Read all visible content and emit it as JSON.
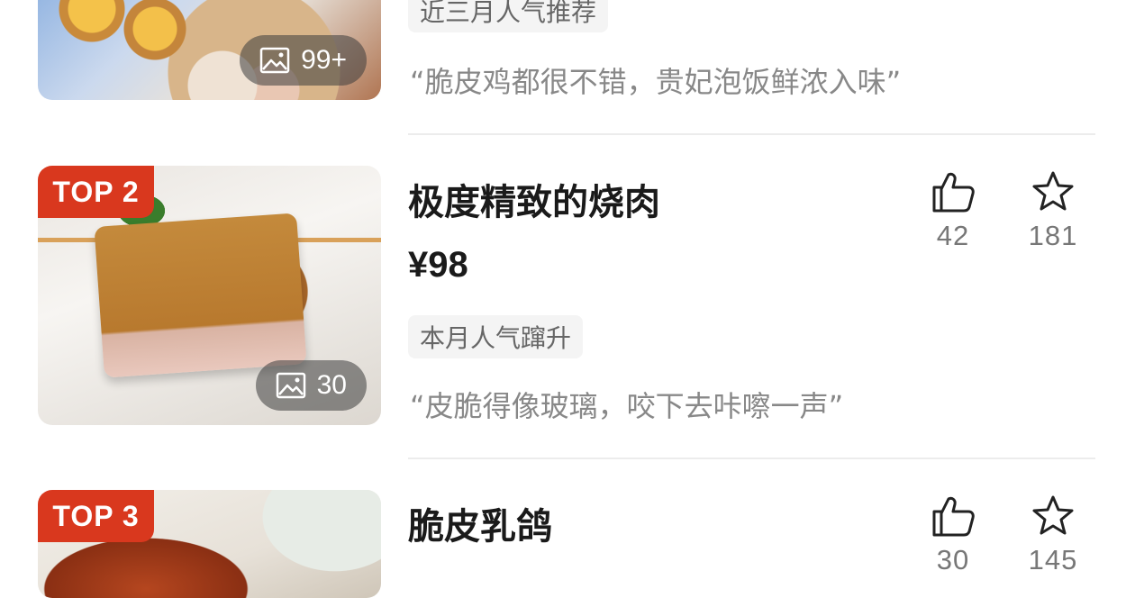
{
  "items": [
    {
      "image_count": "99+",
      "tag": "近三月人气推荐",
      "quote": "“脆皮鸡都很不错，贵妃泡饭鲜浓入味”"
    },
    {
      "rank": "TOP 2",
      "title": "极度精致的烧肉",
      "price": "¥98",
      "tag": "本月人气蹿升",
      "quote": "“皮脆得像玻璃，咬下去咔嚓一声”",
      "image_count": "30",
      "likes": "42",
      "favorites": "181"
    },
    {
      "rank": "TOP 3",
      "title": "脆皮乳鸽",
      "likes": "30",
      "favorites": "145"
    }
  ],
  "icons": {
    "image": "image-icon",
    "like": "thumbs-up-icon",
    "favorite": "star-icon"
  },
  "colors": {
    "rank_badge": "#d9381e",
    "tag_background": "#f4f4f4"
  }
}
